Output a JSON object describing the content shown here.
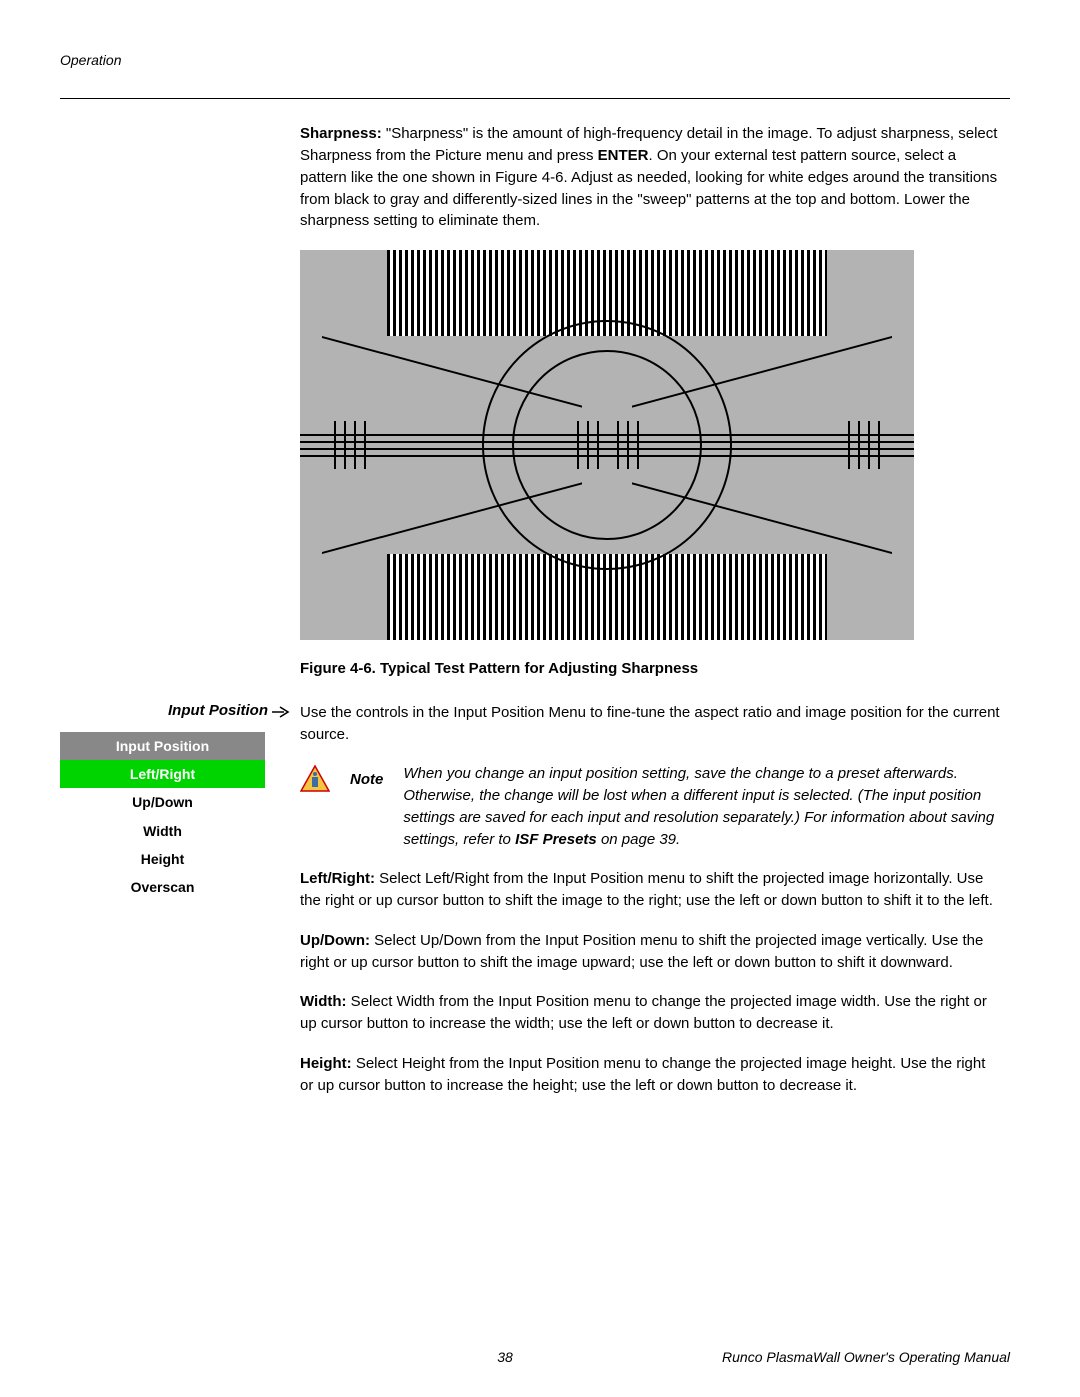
{
  "header": {
    "section": "Operation"
  },
  "sharpness": {
    "label": "Sharpness:",
    "body1": " \"Sharpness\" is the amount of high-frequency detail in the image. To adjust sharpness, select Sharpness from the Picture menu and press ",
    "enter": "ENTER",
    "body2": ". On your external test pattern source, select a pattern like the one shown in Figure 4-6. Adjust as needed, looking for white edges around the transitions from black to gray and differently-sized lines in the \"sweep\" patterns at the top and bottom. Lower the sharpness setting to eliminate them."
  },
  "figure_caption": "Figure 4-6. Typical Test Pattern for Adjusting Sharpness",
  "side_heading": "Input Position",
  "menu": {
    "title": "Input Position",
    "items": [
      "Left/Right",
      "Up/Down",
      "Width",
      "Height",
      "Overscan"
    ],
    "selected_index": 0
  },
  "input_position_intro": "Use the controls in the Input Position Menu to fine-tune the aspect ratio and image position for the current source.",
  "note": {
    "label": "Note",
    "body1": "When you change an input position setting, save the change to a preset afterwards. Otherwise, the change will be lost when a different input is selected. (The input position settings are saved for each input and resolution separately.) For information about saving settings, refer to ",
    "bold": "ISF Presets",
    "body2": " on page 39."
  },
  "p_leftright": {
    "label": "Left/Right:",
    "body": " Select Left/Right from the Input Position menu to shift the projected image horizontally. Use the right or up cursor button to shift the image to the right; use the left or down button to shift it to the left."
  },
  "p_updown": {
    "label": "Up/Down:",
    "body": " Select Up/Down from the Input Position menu to shift the projected image vertically. Use the right or up cursor button to shift the image upward; use the left or down button to shift it downward."
  },
  "p_width": {
    "label": "Width:",
    "body": " Select Width from the Input Position menu to change the projected image width. Use the right or up cursor button to increase the width; use the left or down button to decrease it."
  },
  "p_height": {
    "label": "Height:",
    "body": " Select Height from the Input Position menu to change the projected image height. Use the right or up cursor button to increase the height; use the left or down button to decrease it."
  },
  "footer": {
    "page": "38",
    "title": "Runco PlasmaWall Owner's Operating Manual"
  }
}
